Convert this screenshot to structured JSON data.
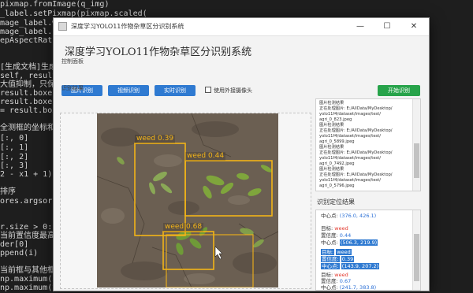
{
  "editor_lines": [
    "pixmap.fromImage(q_img)",
    "_label.setPixmap(pixmap.scaled(",
    "mage_label.width(),",
    "mage_label.height(),",
    "epAspectRatio",
    "",
    "[生成文档]生成测试",
    "self, result, i",
    "大值抑制，只保留",
    "result.boxes.xyxy",
    "result.boxes.con",
    "= result.boxes.",
    "",
    "全测框的坐标和面积",
    "[:, 0]",
    "[:, 1]",
    "[:, 2]",
    "[:, 3]",
    "2 - x1 + 1) * (",
    "",
    "排序",
    "ores.argsort()[",
    "",
    "",
    "r.size > 0:",
    "当前置信度最高的框",
    "der[0]",
    "ppend(i)",
    "",
    "当前框与其他框的",
    "np.maximum(x1[i",
    "np.maximum(y1[i], y1[order[1:]])"
  ],
  "window": {
    "title": "深度学习YOLO11作物杂草区分识别系统",
    "minimize": "—",
    "maximize": "☐",
    "close": "✕"
  },
  "heading": "深度学习YOLO11作物杂草区分识别系统",
  "control_panel": {
    "label": "控制面板",
    "buttons": [
      "图片识别",
      "视频识别",
      "实时识别"
    ],
    "checkbox_label": "使用外接摄像头",
    "start_button": "开始识别"
  },
  "result_label": "识别结果",
  "detections": [
    {
      "label": "weed 0.39"
    },
    {
      "label": "weed 0.44"
    },
    {
      "label": "weed 0.68"
    }
  ],
  "log_lines": [
    "图片检测结果",
    "正在处理图片: E:/AllData/MyDesktop/",
    "yolo11f4/dataset/images/test/",
    "agri_0_823.jpeg",
    "图片检测结果",
    "正在处理图片: E:/AllData/MyDesktop/",
    "yolo11f4/dataset/images/test/",
    "agri_0_5899.jpeg",
    "图片检测结果",
    "正在处理图片: E:/AllData/MyDesktop/",
    "yolo11f4/dataset/images/test/",
    "agri_0_7492.jpeg",
    "图片检测结果",
    "正在处理图片: E:/AllData/MyDesktop/",
    "yolo11f4/dataset/images/test/",
    "agri_0_5796.jpeg",
    "图片检测结果"
  ],
  "location": {
    "title": "识别定位结果",
    "entries": [
      {
        "center_label": "中心点:",
        "center_value": "(376.0, 426.1)"
      },
      {
        "class_label": "目标:",
        "class_value": "weed",
        "conf_label": "置信度:",
        "conf_value": "0.44",
        "center_label": "中心点:",
        "center_value": "(506.3, 219.9)"
      },
      {
        "class_label": "目标:",
        "class_value": "weed",
        "conf_label": "置信度:",
        "conf_value": "0.39",
        "center_label": "中心点:",
        "center_value": "(143.9, 207.2)"
      },
      {
        "class_label": "目标:",
        "class_value": "weed",
        "conf_label": "置信度:",
        "conf_value": "0.67",
        "center_label": "中心点:",
        "center_value": "(241.7, 383.8)"
      }
    ]
  }
}
